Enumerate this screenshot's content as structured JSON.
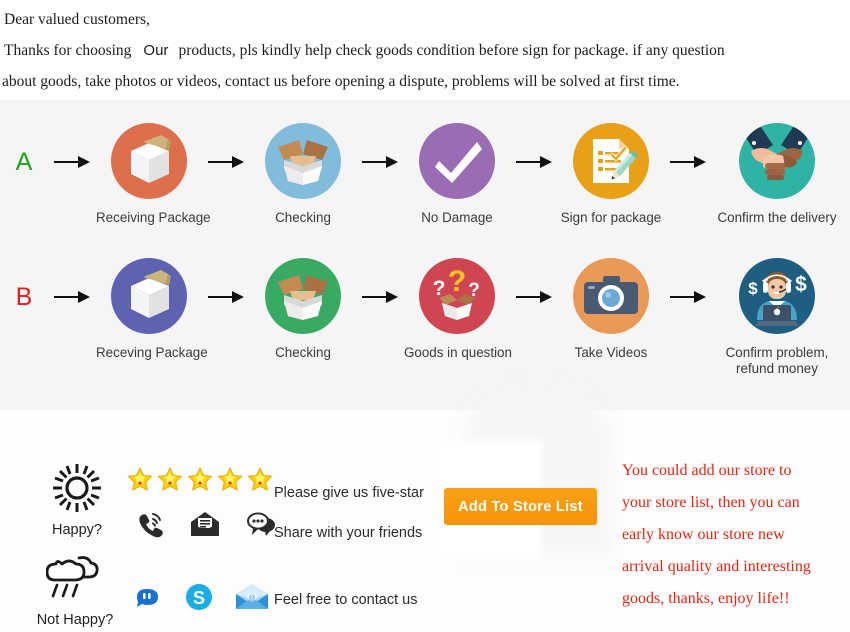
{
  "intro": {
    "line1": "Dear valued customers,",
    "line2_before": "Thanks for choosing",
    "line2_our": "Our",
    "line2_after": "products, pls kindly help check goods condition before sign for package. if any question",
    "line3": "about goods, take photos or videos, contact us before opening a dispute, problems will be solved at first time."
  },
  "flow": {
    "row_a": {
      "letter": "A",
      "letter_color": "#1aa51a",
      "steps": [
        {
          "label": "Receiving Package",
          "icon": "closed-box-icon",
          "circle_color": "#dd6f4c"
        },
        {
          "label": "Checking",
          "icon": "open-box-icon",
          "circle_color": "#82bcdb"
        },
        {
          "label": "No Damage",
          "icon": "check-mark-icon",
          "circle_color": "#9a6cb4"
        },
        {
          "label": "Sign for package",
          "icon": "sign-document-icon",
          "circle_color": "#e8a117"
        },
        {
          "label": "Confirm the delivery",
          "icon": "handshake-icon",
          "circle_color": "#2fb3a4"
        }
      ]
    },
    "row_b": {
      "letter": "B",
      "letter_color": "#e02020",
      "steps": [
        {
          "label": "Receving Package",
          "icon": "closed-box-icon",
          "circle_color": "#5d63b0"
        },
        {
          "label": "Checking",
          "icon": "open-box-icon",
          "circle_color": "#3aa963"
        },
        {
          "label": "Goods in question",
          "icon": "question-box-icon",
          "circle_color": "#cf4652"
        },
        {
          "label": "Take Videos",
          "icon": "camera-icon",
          "circle_color": "#e89a56"
        },
        {
          "label_line1": "Confirm problem,",
          "label_line2": "refund money",
          "icon": "support-agent-icon",
          "circle_color": "#1e5e80"
        }
      ]
    },
    "arrow": "arrow-right-icon"
  },
  "bottom": {
    "happy": {
      "label": "Happy?",
      "icon": "sun-icon"
    },
    "not_happy": {
      "label": "Not Happy?",
      "icon": "rain-cloud-icon"
    },
    "stars": {
      "count": 5,
      "icon": "star-icon",
      "color": "#ffd200"
    },
    "messages": {
      "five_star": "Please give us five-star",
      "share": "Share with your friends",
      "contact": "Feel free to contact us"
    },
    "contact_icons_row1": [
      "phone-ring-icon",
      "envelope-message-icon",
      "chat-bubble-icon"
    ],
    "contact_icons_row2": [
      "aliwangwang-icon",
      "skype-icon",
      "email-envelope-icon"
    ],
    "store_button": {
      "label": "Add To Store List",
      "color": "#f79307"
    },
    "promo": {
      "line1": "You could add our store to",
      "line2": "your store list, then you can",
      "line3": "early know our store new",
      "line4": "arrival quality and interesting",
      "line5": "goods, thanks, enjoy life!!",
      "color": "#e02913"
    }
  }
}
